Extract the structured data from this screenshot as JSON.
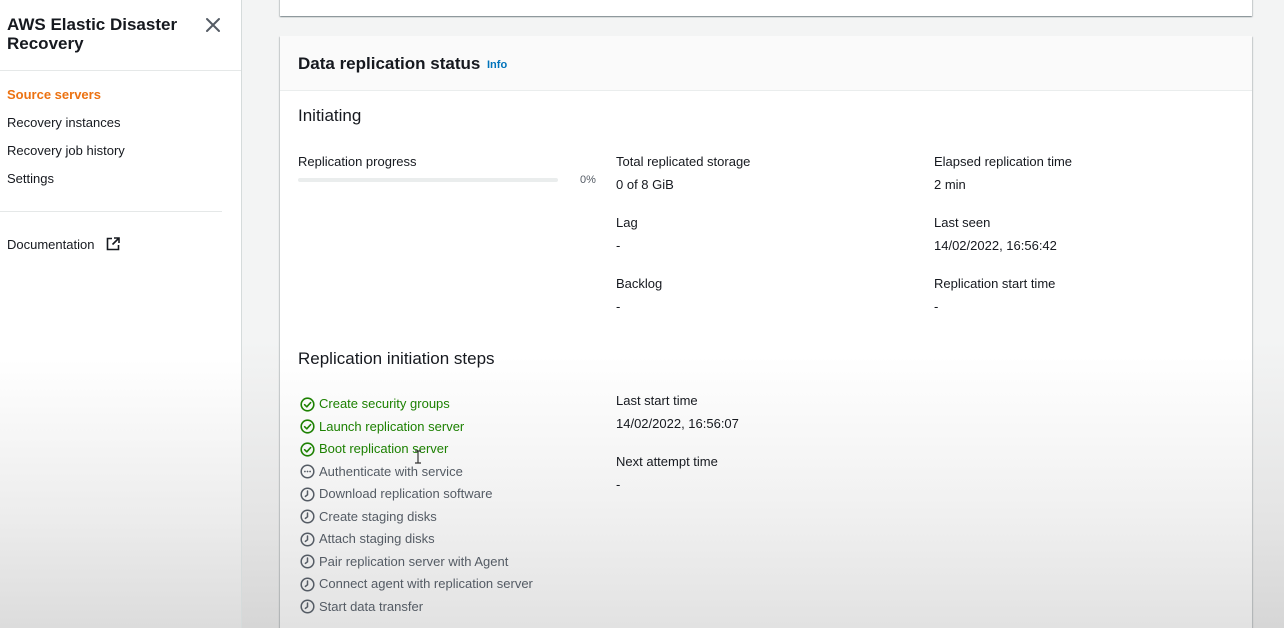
{
  "sidebar": {
    "title": "AWS Elastic Disaster Recovery",
    "nav": [
      {
        "label": "Source servers",
        "active": true
      },
      {
        "label": "Recovery instances",
        "active": false
      },
      {
        "label": "Recovery job history",
        "active": false
      },
      {
        "label": "Settings",
        "active": false
      }
    ],
    "documentation": "Documentation",
    "accent_color": "#ec7211"
  },
  "panel": {
    "title": "Data replication status",
    "info_link": "Info",
    "state": "Initiating",
    "progress": {
      "label": "Replication progress",
      "percent": 0,
      "percent_text": "0%"
    },
    "metrics": {
      "total_replicated_storage": {
        "label": "Total replicated storage",
        "value": "0 of 8 GiB"
      },
      "elapsed_replication_time": {
        "label": "Elapsed replication time",
        "value": "2 min"
      },
      "lag": {
        "label": "Lag",
        "value": "-"
      },
      "last_seen": {
        "label": "Last seen",
        "value": "14/02/2022, 16:56:42"
      },
      "backlog": {
        "label": "Backlog",
        "value": "-"
      },
      "replication_start_time": {
        "label": "Replication start time",
        "value": "-"
      }
    },
    "steps_title": "Replication initiation steps",
    "steps": [
      {
        "label": "Create security groups",
        "status": "success",
        "icon": "check-circle-icon"
      },
      {
        "label": "Launch replication server",
        "status": "success",
        "icon": "check-circle-icon"
      },
      {
        "label": "Boot replication server",
        "status": "success",
        "icon": "check-circle-icon"
      },
      {
        "label": "Authenticate with service",
        "status": "in-progress",
        "icon": "ellipsis-circle-icon"
      },
      {
        "label": "Download replication software",
        "status": "pending",
        "icon": "clock-icon"
      },
      {
        "label": "Create staging disks",
        "status": "pending",
        "icon": "clock-icon"
      },
      {
        "label": "Attach staging disks",
        "status": "pending",
        "icon": "clock-icon"
      },
      {
        "label": "Pair replication server with Agent",
        "status": "pending",
        "icon": "clock-icon"
      },
      {
        "label": "Connect agent with replication server",
        "status": "pending",
        "icon": "clock-icon"
      },
      {
        "label": "Start data transfer",
        "status": "pending",
        "icon": "clock-icon"
      }
    ],
    "last_start_time": {
      "label": "Last start time",
      "value": "14/02/2022, 16:56:07"
    },
    "next_attempt_time": {
      "label": "Next attempt time",
      "value": "-"
    },
    "success_color": "#1d8102",
    "link_color": "#0073bb"
  }
}
